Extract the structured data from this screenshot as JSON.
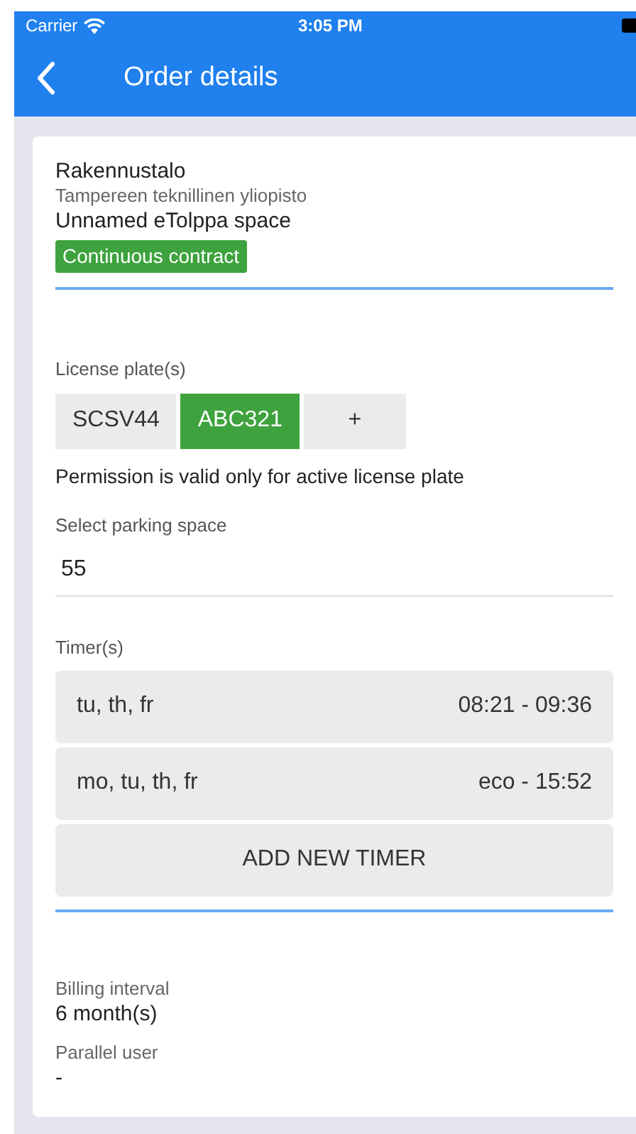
{
  "status_bar": {
    "carrier": "Carrier",
    "time": "3:05 PM"
  },
  "nav_bar": {
    "title": "Order details"
  },
  "order": {
    "name": "Rakennustalo",
    "organization": "Tampereen teknillinen yliopisto",
    "space": "Unnamed eTolppa space",
    "contract_badge": "Continuous contract"
  },
  "license_plates": {
    "label": "License plate(s)",
    "plates": [
      {
        "text": "SCSV44",
        "selected": false
      },
      {
        "text": "ABC321",
        "selected": true
      }
    ],
    "add_button": "+",
    "note": "Permission is valid only for active license plate"
  },
  "parking_space": {
    "label": "Select parking space",
    "value": "55"
  },
  "timers": {
    "label": "Timer(s)",
    "items": [
      {
        "days": "tu, th, fr",
        "time": "08:21 - 09:36"
      },
      {
        "days": "mo, tu, th, fr",
        "time": "eco - 15:52"
      }
    ],
    "add_button": "ADD NEW TIMER"
  },
  "details": [
    {
      "label": "Billing interval",
      "value": "6 month(s)"
    },
    {
      "label": "Parallel user",
      "value": "-"
    }
  ]
}
